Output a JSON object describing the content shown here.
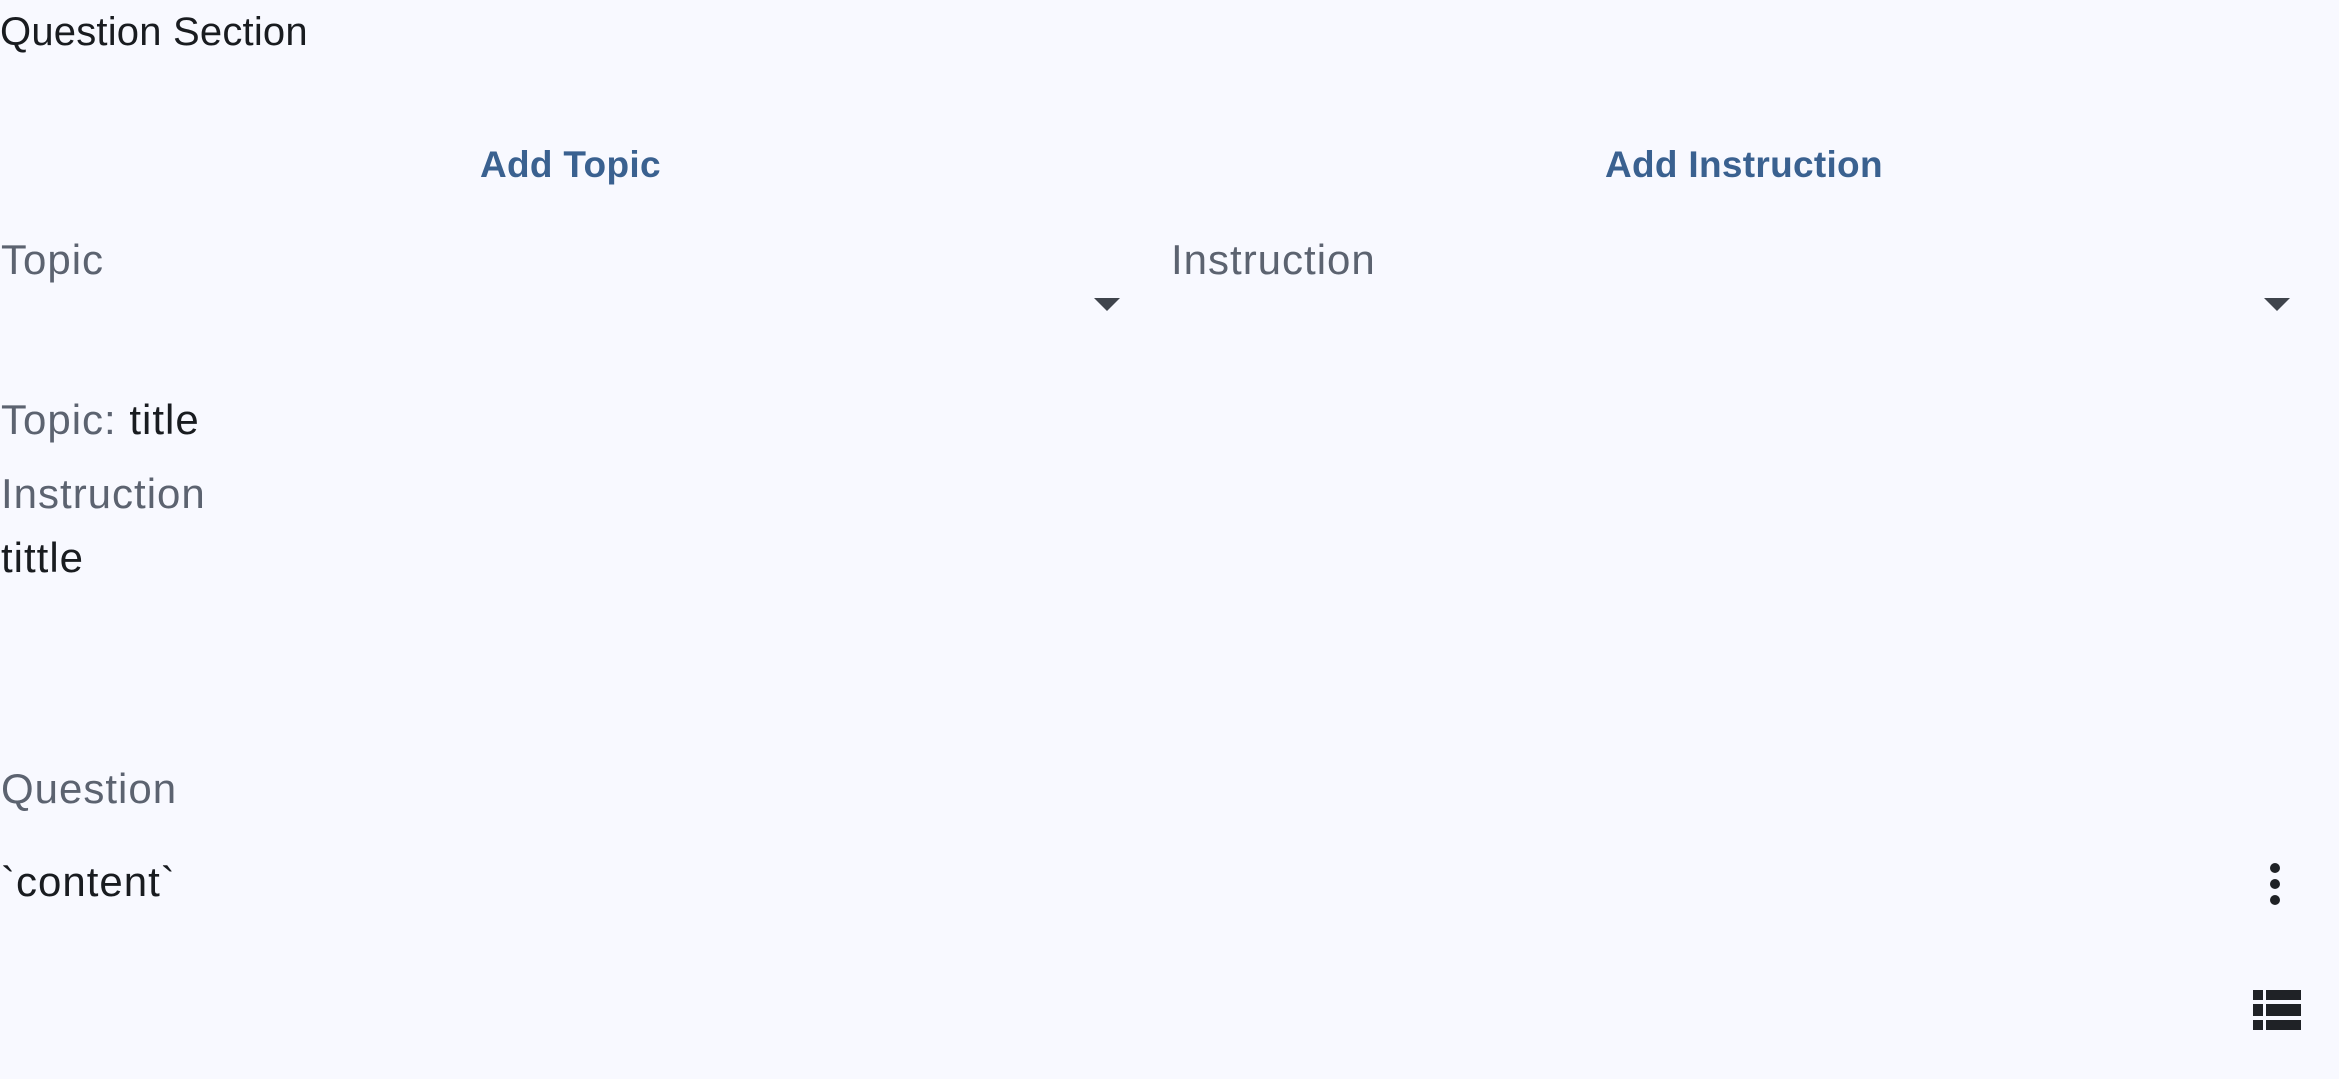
{
  "section": {
    "title": "Question Section"
  },
  "actions": {
    "add_topic_label": "Add Topic",
    "add_instruction_label": "Add Instruction"
  },
  "dropdowns": {
    "topic_label": "Topic",
    "instruction_label": "Instruction"
  },
  "details": {
    "topic_prefix": "Topic: ",
    "topic_value": "title",
    "instruction_label": "Instruction",
    "instruction_value": "tittle"
  },
  "question": {
    "label": "Question",
    "content": "`content`",
    "more_icon": "more-vert-icon",
    "list_icon": "view-list-icon"
  },
  "colors": {
    "background": "#f8f9ff",
    "primary": "#3a6190",
    "muted_text": "#5c6370",
    "text": "#191c20"
  }
}
